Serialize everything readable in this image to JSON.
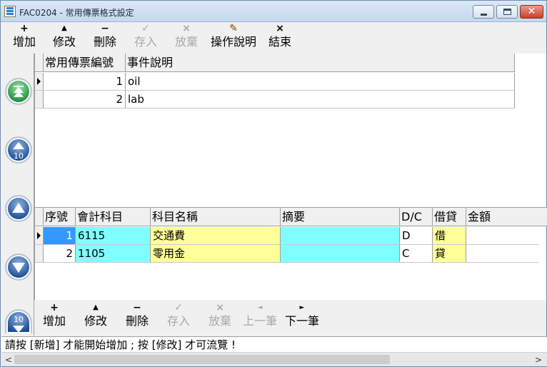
{
  "window": {
    "title": "FAC0204 - 常用傳票格式設定",
    "icon": "app-icon"
  },
  "main_toolbar": [
    {
      "icon": "+",
      "label": "增加",
      "enabled": true
    },
    {
      "icon": "▲",
      "label": "修改",
      "enabled": true
    },
    {
      "icon": "−",
      "label": "刪除",
      "enabled": true
    },
    {
      "icon": "✓",
      "label": "存入",
      "enabled": false
    },
    {
      "icon": "×",
      "label": "放棄",
      "enabled": false
    },
    {
      "icon": "✎",
      "label": "操作說明",
      "enabled": true
    },
    {
      "icon": "×",
      "label": "結束",
      "enabled": true
    }
  ],
  "left_nav": [
    {
      "name": "first-record-icon",
      "label": ""
    },
    {
      "name": "page-up-10-icon",
      "label": "10"
    },
    {
      "name": "previous-record-icon",
      "label": ""
    },
    {
      "name": "next-record-icon",
      "label": ""
    },
    {
      "name": "page-down-10-icon",
      "label": "10"
    }
  ],
  "master_grid": {
    "columns": [
      "常用傳票編號",
      "事件說明"
    ],
    "rows": [
      {
        "id": "1",
        "desc": "oil"
      },
      {
        "id": "2",
        "desc": "lab"
      }
    ]
  },
  "detail_grid": {
    "columns": [
      "序號",
      "會計科目",
      "科目名稱",
      "摘要",
      "D/C",
      "借貸",
      "金額"
    ],
    "rows": [
      {
        "seq": "1",
        "account": "6115",
        "account_name": "交通費",
        "summary": "",
        "dc": "D",
        "dc_label": "借",
        "amount": ""
      },
      {
        "seq": "2",
        "account": "1105",
        "account_name": "零用金",
        "summary": "",
        "dc": "C",
        "dc_label": "貸",
        "amount": ""
      }
    ]
  },
  "detail_toolbar": [
    {
      "icon": "+",
      "label": "增加",
      "enabled": true
    },
    {
      "icon": "▲",
      "label": "修改",
      "enabled": true
    },
    {
      "icon": "−",
      "label": "刪除",
      "enabled": true
    },
    {
      "icon": "✓",
      "label": "存入",
      "enabled": false
    },
    {
      "icon": "×",
      "label": "放棄",
      "enabled": false
    },
    {
      "icon": "◄",
      "label": "上一筆",
      "enabled": false
    },
    {
      "icon": "►",
      "label": "下一筆",
      "enabled": true
    }
  ],
  "status": {
    "text": "請按 [新增] 才能開始增加 ; 按 [修改] 才可流覽 !"
  },
  "colors": {
    "cyan": "#80ffff",
    "yellow": "#ffff99",
    "selection": "#3399ff"
  }
}
